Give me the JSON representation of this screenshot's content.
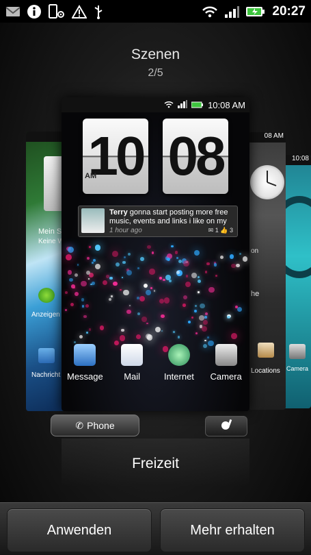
{
  "status_bar": {
    "time": "20:27",
    "left_icons": [
      "gmail-icon",
      "info-icon",
      "settings-phone-icon",
      "warning-icon",
      "usb-icon"
    ],
    "right_icons": [
      "wifi-icon",
      "signal-icon",
      "battery-icon"
    ]
  },
  "header": {
    "title": "Szenen",
    "pager": "2/5"
  },
  "main_scene": {
    "status_time": "10:08 AM",
    "clock_hour": "10",
    "clock_minute": "08",
    "clock_ampm": "AM",
    "facebook": {
      "name": "Terry",
      "message": "gonna start  posting more free music, events and links i like on my",
      "time": "1 hour ago",
      "comments": "1",
      "likes": "3"
    },
    "dock": [
      {
        "label": "Message",
        "icon": "message-icon"
      },
      {
        "label": "Mail",
        "icon": "mail-icon"
      },
      {
        "label": "Internet",
        "icon": "internet-icon"
      },
      {
        "label": "Camera",
        "icon": "camera-icon"
      }
    ],
    "phone_label": "Phone",
    "scene_name": "Freizeit"
  },
  "left_scene": {
    "labels": [
      "Mein St",
      "Keine W",
      "Anzeigen",
      "Nachricht"
    ]
  },
  "right_scene": {
    "time": "08 AM",
    "labels": [
      "on",
      "he",
      "Locations"
    ]
  },
  "right_scene2": {
    "time": "10:08",
    "labels": [
      "Camera"
    ]
  },
  "actions": {
    "apply": "Anwenden",
    "get_more": "Mehr erhalten"
  },
  "colors": {
    "accent_green": "#3ec43e",
    "status_bg": "#000000"
  }
}
